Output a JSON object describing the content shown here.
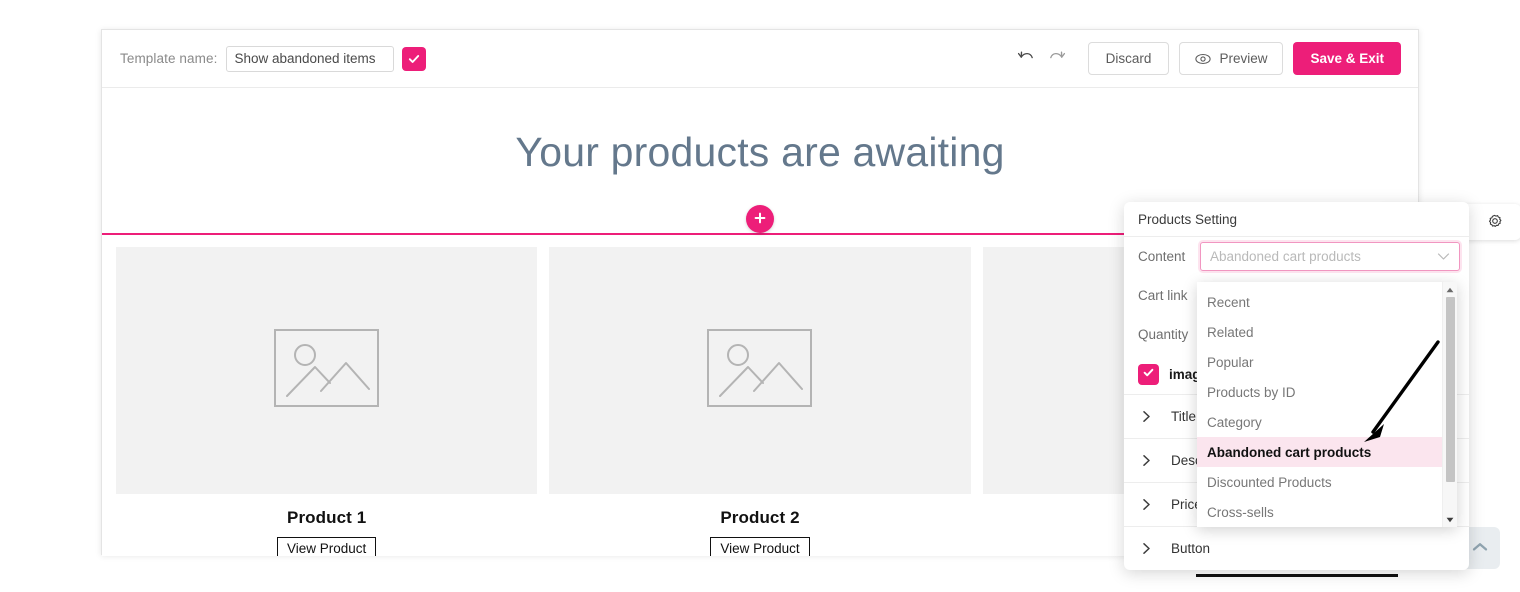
{
  "topbar": {
    "template_name_label": "Template name:",
    "template_name_value": "Show abandoned items",
    "template_name_placeholder": "Template name",
    "confirm_icon": "check-icon",
    "undo_icon": "undo-arrow-icon",
    "redo_icon": "redo-arrow-icon",
    "discard_label": "Discard",
    "preview_label": "Preview",
    "preview_icon": "eye-icon",
    "save_exit_label": "Save & Exit"
  },
  "canvas": {
    "heading": "Your products are awaiting",
    "heading_color": "#64788c",
    "add_block_icon": "plus-icon",
    "divider_color": "#ed1e79",
    "products": [
      {
        "title": "Product 1",
        "button_label": "View Product",
        "image_icon": "image-placeholder-icon"
      },
      {
        "title": "Product 2",
        "button_label": "View Product",
        "image_icon": "image-placeholder-icon"
      },
      {
        "title": "",
        "button_label": "",
        "image_icon": "image-placeholder-icon"
      }
    ]
  },
  "settings_tab": {
    "gear_icon": "gear-icon"
  },
  "collapse_button": {
    "icon": "chevron-up-icon"
  },
  "panel": {
    "title": "Products Setting",
    "content_label": "Content",
    "content_value": "Abandoned cart products",
    "content_chevron_icon": "chevron-down-icon",
    "cart_link_label": "Cart link",
    "quantity_label": "Quantity",
    "image_checkbox_label": "image",
    "image_checkbox_checked": true,
    "accordions": [
      {
        "label": "Title",
        "icon": "chevron-right-icon"
      },
      {
        "label": "Description",
        "icon": "chevron-right-icon"
      },
      {
        "label": "Price",
        "icon": "chevron-right-icon"
      },
      {
        "label": "Button",
        "icon": "chevron-right-icon"
      }
    ]
  },
  "dropdown": {
    "options": [
      {
        "label": "Recent",
        "selected": false
      },
      {
        "label": "Related",
        "selected": false
      },
      {
        "label": "Popular",
        "selected": false
      },
      {
        "label": "Products by ID",
        "selected": false
      },
      {
        "label": "Category",
        "selected": false
      },
      {
        "label": "Abandoned cart products",
        "selected": true
      },
      {
        "label": "Discounted Products",
        "selected": false
      },
      {
        "label": "Cross-sells",
        "selected": false
      }
    ],
    "scroll_up_icon": "triangle-up-icon",
    "scroll_down_icon": "triangle-down-icon"
  },
  "colors": {
    "accent": "#ed1e79",
    "highlight": "#fbe5ee",
    "heading": "#64788c"
  }
}
